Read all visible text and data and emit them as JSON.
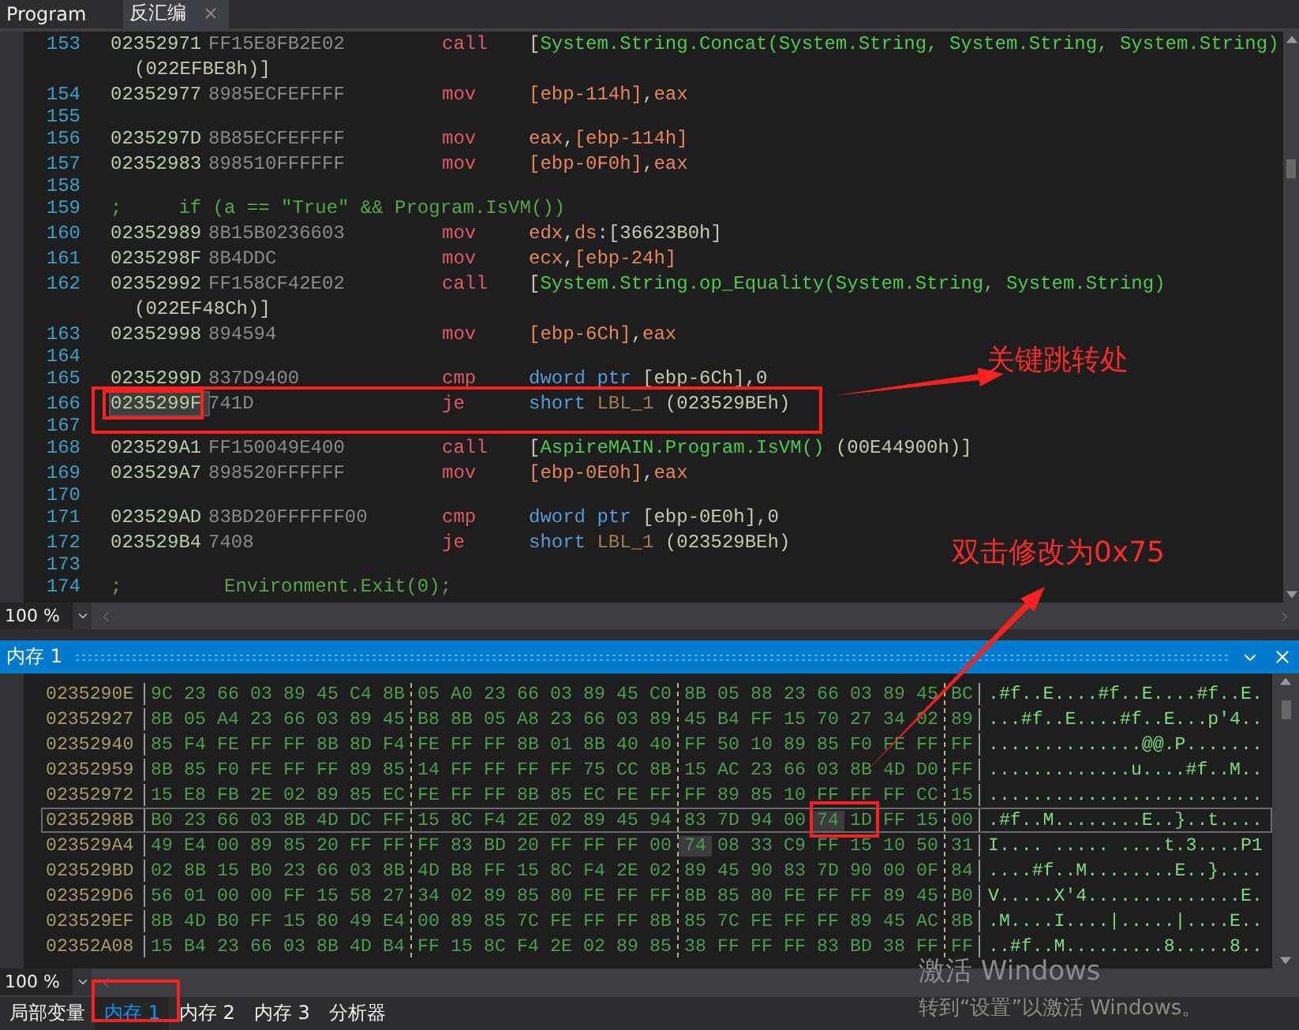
{
  "tabs": [
    {
      "label": "Program",
      "selected": false,
      "closable": false
    },
    {
      "label": "反汇编",
      "selected": true,
      "closable": true
    }
  ],
  "disassembly": {
    "rows": [
      {
        "kind": "code",
        "line": "153",
        "address": "02352971",
        "bytes": "FF15E8FB2E02",
        "mnemonic": "call",
        "operand": [
          {
            "text": "[",
            "kind": "plain"
          },
          {
            "text": "System.String.Concat(System.String, System.String, System.String)",
            "kind": "symbol"
          }
        ],
        "wrap": "(022EFBE8h)]",
        "selected": false
      },
      {
        "kind": "code",
        "line": "154",
        "address": "02352977",
        "bytes": "8985ECFEFFFF",
        "mnemonic": "mov",
        "operand": [
          {
            "text": "[ebp-114h]",
            "kind": "reg"
          },
          {
            "text": ",",
            "kind": "plain"
          },
          {
            "text": "eax",
            "kind": "reg"
          }
        ],
        "selected": false
      },
      {
        "kind": "empty",
        "line": "155"
      },
      {
        "kind": "code",
        "line": "156",
        "address": "0235297D",
        "bytes": "8B85ECFEFFFF",
        "mnemonic": "mov",
        "operand": [
          {
            "text": "eax",
            "kind": "reg"
          },
          {
            "text": ",",
            "kind": "plain"
          },
          {
            "text": "[ebp-114h]",
            "kind": "reg"
          }
        ],
        "selected": false
      },
      {
        "kind": "code",
        "line": "157",
        "address": "02352983",
        "bytes": "898510FFFFFF",
        "mnemonic": "mov",
        "operand": [
          {
            "text": "[ebp-0F0h]",
            "kind": "reg"
          },
          {
            "text": ",",
            "kind": "plain"
          },
          {
            "text": "eax",
            "kind": "reg"
          }
        ],
        "selected": false
      },
      {
        "kind": "empty",
        "line": "158"
      },
      {
        "kind": "comment",
        "line": "159",
        "text": ";     if (a == \"True\" && Program.IsVM())"
      },
      {
        "kind": "code",
        "line": "160",
        "address": "02352989",
        "bytes": "8B15B0236603",
        "mnemonic": "mov",
        "operand": [
          {
            "text": "edx",
            "kind": "reg"
          },
          {
            "text": ",",
            "kind": "plain"
          },
          {
            "text": "ds",
            "kind": "reg"
          },
          {
            "text": ":[36623B0h]",
            "kind": "plain"
          }
        ],
        "selected": false
      },
      {
        "kind": "code",
        "line": "161",
        "address": "0235298F",
        "bytes": "8B4DDC",
        "mnemonic": "mov",
        "operand": [
          {
            "text": "ecx",
            "kind": "reg"
          },
          {
            "text": ",",
            "kind": "plain"
          },
          {
            "text": "[ebp-24h]",
            "kind": "reg"
          }
        ],
        "selected": false
      },
      {
        "kind": "code",
        "line": "162",
        "address": "02352992",
        "bytes": "FF158CF42E02",
        "mnemonic": "call",
        "operand": [
          {
            "text": "[",
            "kind": "plain"
          },
          {
            "text": "System.String.op_Equality(System.String, System.String)",
            "kind": "symbol"
          }
        ],
        "wrap": "(022EF48Ch)]",
        "selected": false
      },
      {
        "kind": "code",
        "line": "163",
        "address": "02352998",
        "bytes": "894594",
        "mnemonic": "mov",
        "operand": [
          {
            "text": "[ebp-6Ch]",
            "kind": "reg"
          },
          {
            "text": ",",
            "kind": "plain"
          },
          {
            "text": "eax",
            "kind": "reg"
          }
        ],
        "selected": false
      },
      {
        "kind": "empty",
        "line": "164"
      },
      {
        "kind": "code",
        "line": "165",
        "address": "0235299D",
        "bytes": "837D9400",
        "mnemonic": "cmp",
        "operand": [
          {
            "text": "dword ptr",
            "kind": "keyword"
          },
          {
            "text": " [ebp-6Ch],0",
            "kind": "plain"
          }
        ],
        "selected": false
      },
      {
        "kind": "code",
        "line": "166",
        "address": "0235299F",
        "bytes": "741D",
        "mnemonic": "je",
        "operand": [
          {
            "text": "short",
            "kind": "keyword"
          },
          {
            "text": " LBL_1",
            "kind": "label"
          },
          {
            "text": " (023529BEh)",
            "kind": "plain"
          }
        ],
        "selected": true
      },
      {
        "kind": "empty",
        "line": "167"
      },
      {
        "kind": "code",
        "line": "168",
        "address": "023529A1",
        "bytes": "FF150049E400",
        "mnemonic": "call",
        "operand": [
          {
            "text": "[",
            "kind": "plain"
          },
          {
            "text": "AspireMAIN.Program.IsVM()",
            "kind": "symbol"
          },
          {
            "text": " (00E44900h)]",
            "kind": "plain"
          }
        ],
        "selected": false
      },
      {
        "kind": "code",
        "line": "169",
        "address": "023529A7",
        "bytes": "898520FFFFFF",
        "mnemonic": "mov",
        "operand": [
          {
            "text": "[ebp-0E0h]",
            "kind": "reg"
          },
          {
            "text": ",",
            "kind": "plain"
          },
          {
            "text": "eax",
            "kind": "reg"
          }
        ],
        "selected": false
      },
      {
        "kind": "empty",
        "line": "170"
      },
      {
        "kind": "code",
        "line": "171",
        "address": "023529AD",
        "bytes": "83BD20FFFFFF00",
        "mnemonic": "cmp",
        "operand": [
          {
            "text": "dword ptr",
            "kind": "keyword"
          },
          {
            "text": " [ebp-0E0h],0",
            "kind": "plain"
          }
        ],
        "selected": false
      },
      {
        "kind": "code",
        "line": "172",
        "address": "023529B4",
        "bytes": "7408",
        "mnemonic": "je",
        "operand": [
          {
            "text": "short",
            "kind": "keyword"
          },
          {
            "text": " LBL_1",
            "kind": "label"
          },
          {
            "text": " (023529BEh)",
            "kind": "plain"
          }
        ],
        "selected": false
      },
      {
        "kind": "empty",
        "line": "173"
      },
      {
        "kind": "comment",
        "line": "174",
        "text": ";         Environment.Exit(0);"
      }
    ],
    "zoom": "100 %"
  },
  "memory": {
    "title": "内存 1",
    "rows": [
      {
        "address": "0235290E",
        "bytes": [
          "9C",
          "23",
          "66",
          "03",
          "89",
          "45",
          "C4",
          "8B",
          "05",
          "A0",
          "23",
          "66",
          "03",
          "89",
          "45",
          "C0",
          "8B",
          "05",
          "88",
          "23",
          "66",
          "03",
          "89",
          "45",
          "BC"
        ],
        "ascii": ".#f..E....#f..E....#f..E.",
        "selected": false
      },
      {
        "address": "02352927",
        "bytes": [
          "8B",
          "05",
          "A4",
          "23",
          "66",
          "03",
          "89",
          "45",
          "B8",
          "8B",
          "05",
          "A8",
          "23",
          "66",
          "03",
          "89",
          "45",
          "B4",
          "FF",
          "15",
          "70",
          "27",
          "34",
          "02",
          "89"
        ],
        "ascii": "...#f..E....#f..E...p'4..",
        "selected": false
      },
      {
        "address": "02352940",
        "bytes": [
          "85",
          "F4",
          "FE",
          "FF",
          "FF",
          "8B",
          "8D",
          "F4",
          "FE",
          "FF",
          "FF",
          "8B",
          "01",
          "8B",
          "40",
          "40",
          "FF",
          "50",
          "10",
          "89",
          "85",
          "F0",
          "FE",
          "FF",
          "FF"
        ],
        "ascii": "..............@@.P.......",
        "selected": false
      },
      {
        "address": "02352959",
        "bytes": [
          "8B",
          "85",
          "F0",
          "FE",
          "FF",
          "FF",
          "89",
          "85",
          "14",
          "FF",
          "FF",
          "FF",
          "FF",
          "75",
          "CC",
          "8B",
          "15",
          "AC",
          "23",
          "66",
          "03",
          "8B",
          "4D",
          "D0",
          "FF"
        ],
        "ascii": ".............u....#f..M..",
        "selected": false
      },
      {
        "address": "02352972",
        "bytes": [
          "15",
          "E8",
          "FB",
          "2E",
          "02",
          "89",
          "85",
          "EC",
          "FE",
          "FF",
          "FF",
          "8B",
          "85",
          "EC",
          "FE",
          "FF",
          "FF",
          "89",
          "85",
          "10",
          "FF",
          "FF",
          "FF",
          "CC",
          "15"
        ],
        "ascii": ".........................",
        "selected": false
      },
      {
        "address": "0235298B",
        "bytes": [
          "B0",
          "23",
          "66",
          "03",
          "8B",
          "4D",
          "DC",
          "FF",
          "15",
          "8C",
          "F4",
          "2E",
          "02",
          "89",
          "45",
          "94",
          "83",
          "7D",
          "94",
          "00",
          {
            "value": "74",
            "highlighted": true
          },
          "1D",
          "FF",
          "15",
          "00"
        ],
        "ascii": ".#f..M........E..}..t....",
        "selected": true
      },
      {
        "address": "023529A4",
        "bytes": [
          "49",
          "E4",
          "00",
          "89",
          "85",
          "20",
          "FF",
          "FF",
          "FF",
          "83",
          "BD",
          "20",
          "FF",
          "FF",
          "FF",
          "00",
          {
            "value": "74",
            "highlighted": true
          },
          "08",
          "33",
          "C9",
          "FF",
          "15",
          "10",
          "50",
          "31"
        ],
        "ascii": "I.... ..... ....t.3....P1",
        "selected": false
      },
      {
        "address": "023529BD",
        "bytes": [
          "02",
          "8B",
          "15",
          "B0",
          "23",
          "66",
          "03",
          "8B",
          "4D",
          "B8",
          "FF",
          "15",
          "8C",
          "F4",
          "2E",
          "02",
          "89",
          "45",
          "90",
          "83",
          "7D",
          "90",
          "00",
          "0F",
          "84"
        ],
        "ascii": "....#f..M........E..}....",
        "selected": false
      },
      {
        "address": "023529D6",
        "bytes": [
          "56",
          "01",
          "00",
          "00",
          "FF",
          "15",
          "58",
          "27",
          "34",
          "02",
          "89",
          "85",
          "80",
          "FE",
          "FF",
          "FF",
          "8B",
          "85",
          "80",
          "FE",
          "FF",
          "FF",
          "89",
          "45",
          "B0"
        ],
        "ascii": "V.....X'4..............E.",
        "selected": false
      },
      {
        "address": "023529EF",
        "bytes": [
          "8B",
          "4D",
          "B0",
          "FF",
          "15",
          "80",
          "49",
          "E4",
          "00",
          "89",
          "85",
          "7C",
          "FE",
          "FF",
          "FF",
          "8B",
          "85",
          "7C",
          "FE",
          "FF",
          "FF",
          "89",
          "45",
          "AC",
          "8B"
        ],
        "ascii": ".M....I....|.....|....E..",
        "selected": false
      },
      {
        "address": "02352A08",
        "bytes": [
          "15",
          "B4",
          "23",
          "66",
          "03",
          "8B",
          "4D",
          "B4",
          "FF",
          "15",
          "8C",
          "F4",
          "2E",
          "02",
          "89",
          "85",
          "38",
          "FF",
          "FF",
          "FF",
          "83",
          "BD",
          "38",
          "FF",
          "FF"
        ],
        "ascii": "..#f..M.........8.....8..",
        "selected": false
      }
    ],
    "zoom": "100 %"
  },
  "bottom_tabs": [
    {
      "label": "局部变量",
      "selected": false
    },
    {
      "label": "内存 1",
      "selected": true
    },
    {
      "label": "内存 2",
      "selected": false
    },
    {
      "label": "内存 3",
      "selected": false
    },
    {
      "label": "分析器",
      "selected": false
    }
  ],
  "annotations": [
    {
      "text": "关键跳转处"
    },
    {
      "text": "双击修改为0x75"
    }
  ],
  "activation_notice": {
    "title": "激活 Windows",
    "subtitle": "转到“设置”以激活 Windows。"
  }
}
